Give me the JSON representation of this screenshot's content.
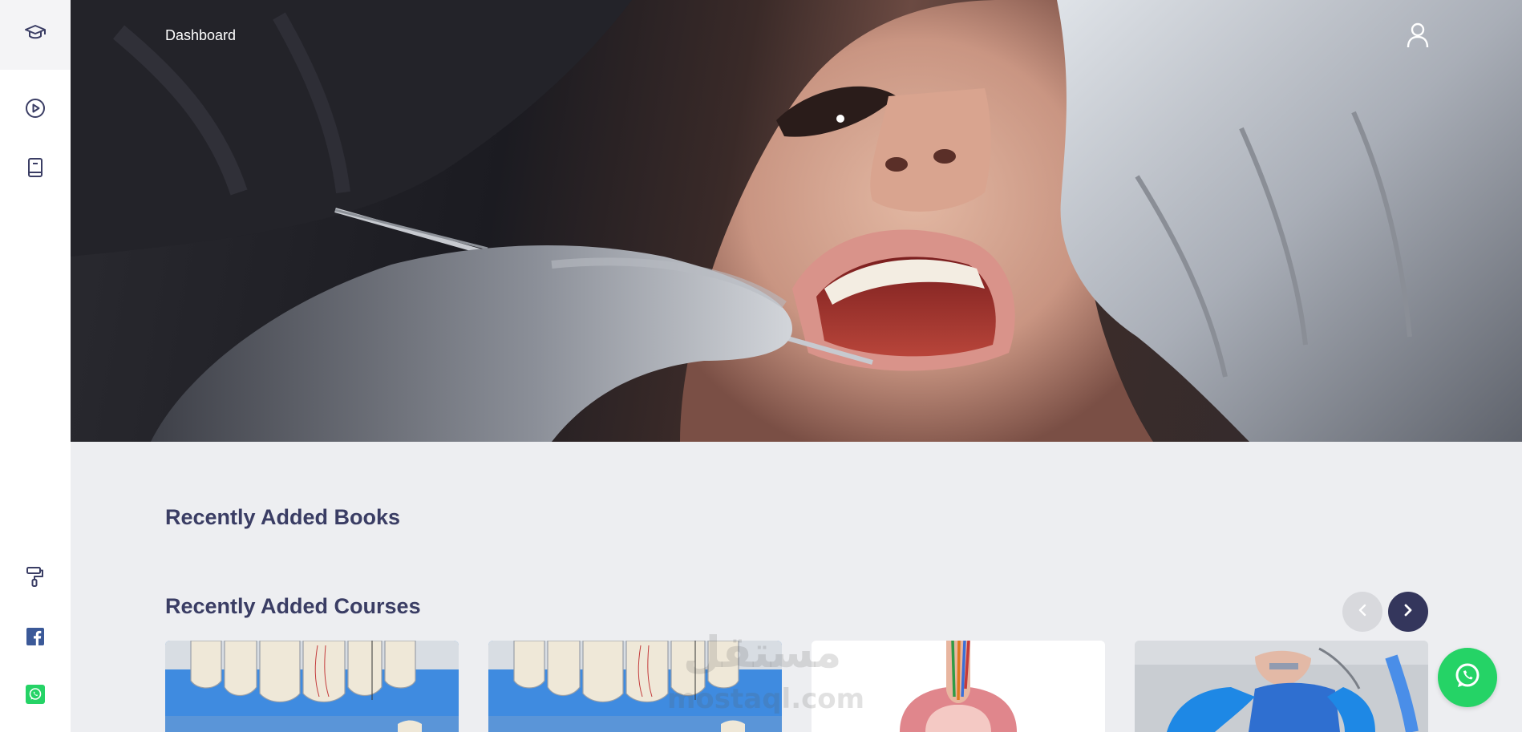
{
  "header": {
    "title": "Dashboard",
    "user_icon": "user-icon"
  },
  "sidebar": {
    "logo_icon": "graduation-cap-icon",
    "items": [
      {
        "icon": "play-circle-icon"
      },
      {
        "icon": "book-icon"
      },
      {
        "icon": "paint-roller-icon"
      },
      {
        "icon": "facebook-icon",
        "color": "#3b5998"
      },
      {
        "icon": "whatsapp-icon",
        "color": "#25d366"
      }
    ]
  },
  "hero": {
    "image": "dentist-examining-patient-photo"
  },
  "sections": {
    "books_title": "Recently Added Books",
    "courses_title": "Recently Added Courses"
  },
  "carousel": {
    "prev_icon": "chevron-left-icon",
    "next_icon": "chevron-right-icon",
    "cards": [
      {
        "image": "veneer-teeth-photo"
      },
      {
        "image": "veneer-teeth-photo"
      },
      {
        "image": "tooth-root-canal-illustration"
      },
      {
        "image": "dental-rubber-dam-photo"
      }
    ]
  },
  "watermark": {
    "arabic": "مستقل",
    "latin": "mostaql.com"
  },
  "fab": {
    "icon": "whatsapp-icon",
    "color": "#25d366"
  },
  "colors": {
    "accent": "#3a3d64",
    "background": "#edeef1"
  }
}
